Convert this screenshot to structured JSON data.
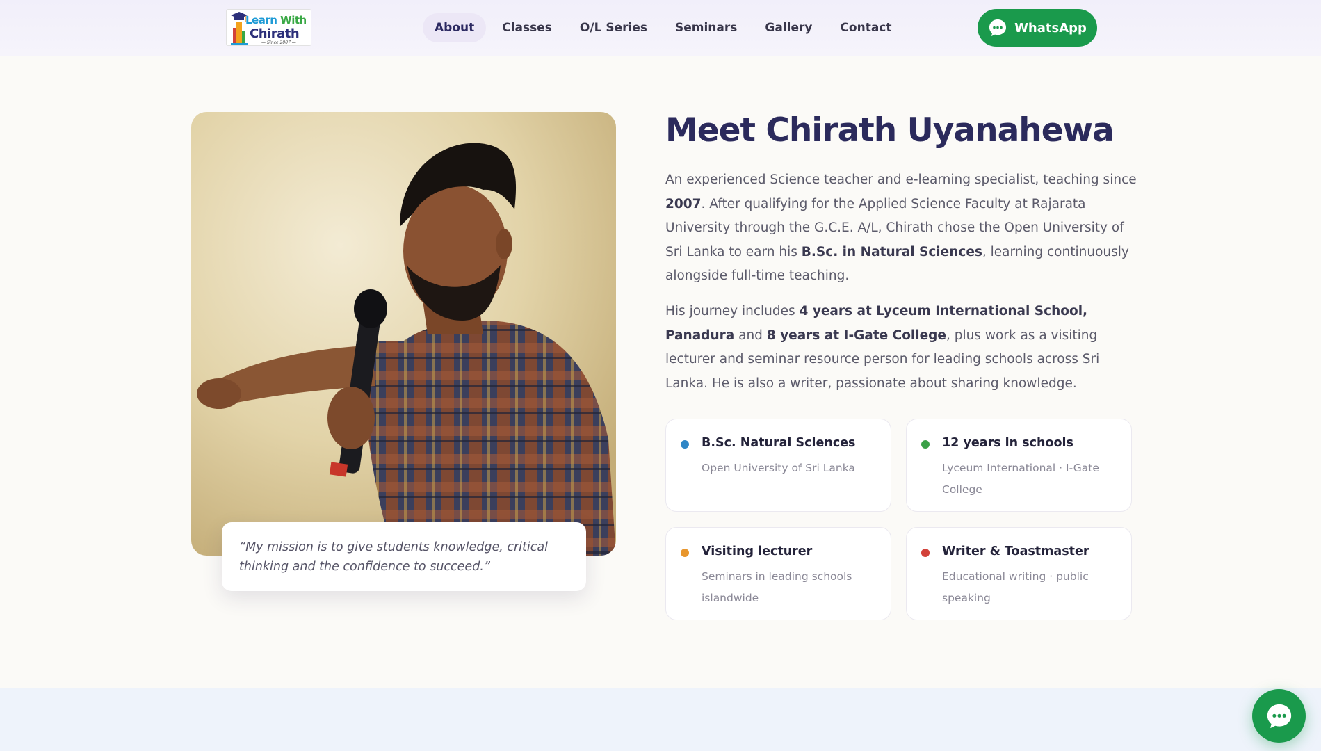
{
  "header": {
    "logo": {
      "line1_a": "Learn",
      "line1_b": "With",
      "line2": "Chirath",
      "tagline": "— Since 2007 —"
    },
    "nav": [
      {
        "label": "About",
        "active": true
      },
      {
        "label": "Classes"
      },
      {
        "label": "O/L Series"
      },
      {
        "label": "Seminars"
      },
      {
        "label": "Gallery"
      },
      {
        "label": "Contact"
      }
    ],
    "whatsapp_label": "WhatsApp"
  },
  "about": {
    "title": "Meet Chirath Uyanahewa",
    "quote": "“My mission is to give students knowledge, critical thinking and the confidence to succeed.”",
    "para1": {
      "t1": "An experienced Science teacher and e-learning specialist, teaching since ",
      "b1": "2007",
      "t2": ". After qualifying for the Applied Science Faculty at Rajarata University through the G.C.E. A/L, Chirath chose the Open University of Sri Lanka to earn his ",
      "b2": "B.Sc. in Natural Sciences",
      "t3": ", learning continuously alongside full-time teaching."
    },
    "para2": {
      "t1": "His journey includes ",
      "b1": "4 years at Lyceum International School, Panadura",
      "t2": " and ",
      "b2": "8 years at I-Gate College",
      "t3": ", plus work as a visiting lecturer and seminar resource person for leading schools across Sri Lanka. He is also a writer, passionate about sharing knowledge."
    },
    "cards": [
      {
        "title": "B.Sc. Natural Sciences",
        "subtitle": "Open University of Sri Lanka",
        "color": "#2f86c6"
      },
      {
        "title": "12 years in schools",
        "subtitle": "Lyceum International · I-Gate College",
        "color": "#3aa047"
      },
      {
        "title": "Visiting lecturer",
        "subtitle": "Seminars in leading schools islandwide",
        "color": "#e8962d"
      },
      {
        "title": "Writer & Toastmaster",
        "subtitle": "Educational writing · public speaking",
        "color": "#d2423a"
      }
    ]
  },
  "colors": {
    "accent": "#2b2a5c",
    "whatsapp": "#1a9a4c",
    "background": "#fbfaf7"
  },
  "icons": {
    "whatsapp_button": "chat-bubble-icon",
    "floating_button": "chat-bubble-icon"
  }
}
